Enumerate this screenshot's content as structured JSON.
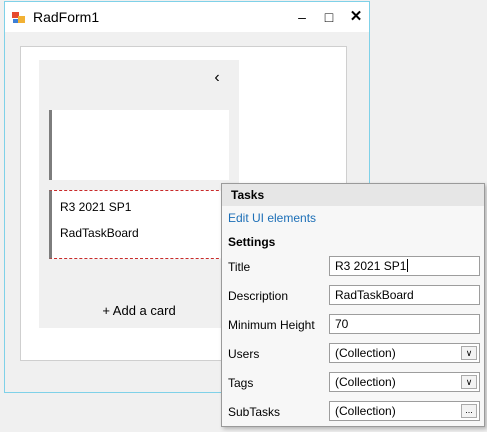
{
  "window": {
    "title": "RadForm1",
    "minimize": "–",
    "maximize": "□",
    "close": "✕"
  },
  "board": {
    "collapse_glyph": "‹",
    "card2": {
      "title": "R3 2021 SP1",
      "description": "RadTaskBoard"
    },
    "add_card": "+ Add a card"
  },
  "panel": {
    "header": "Tasks",
    "edit_link": "Edit UI elements",
    "settings_header": "Settings",
    "rows": [
      {
        "label": "Title",
        "value": "R3 2021 SP1"
      },
      {
        "label": "Description",
        "value": "RadTaskBoard"
      },
      {
        "label": "Minimum Height",
        "value": "70"
      },
      {
        "label": "Users",
        "value": "(Collection)"
      },
      {
        "label": "Tags",
        "value": "(Collection)"
      },
      {
        "label": "SubTasks",
        "value": "(Collection)"
      }
    ],
    "dropdown_glyph": "∨",
    "ellipsis": "..."
  },
  "colors": {
    "accent_border": "#7fd1e8",
    "link": "#1c6fb7",
    "selection_dash": "#c82a2a"
  }
}
